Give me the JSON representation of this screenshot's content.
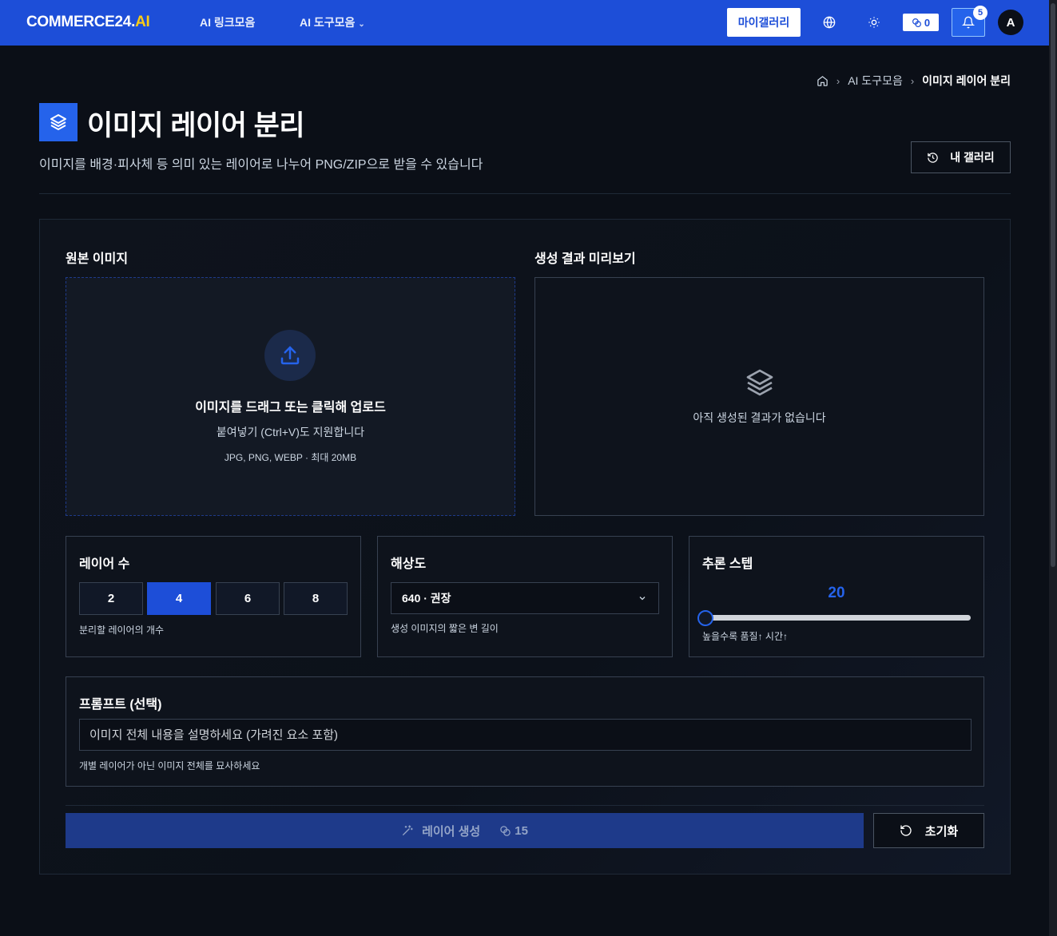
{
  "header": {
    "logo_main": "COMMERCE24.",
    "logo_accent": "AI",
    "nav": [
      {
        "label": "AI 링크모음"
      },
      {
        "label": "AI 도구모음"
      }
    ],
    "my_gallery_label": "마이갤러리",
    "credits": "0",
    "notification_count": "5",
    "avatar_initial": "A",
    "icons": {
      "language": "globe-icon",
      "theme": "sun-icon",
      "credits": "coins-icon",
      "notifications": "bell-icon"
    }
  },
  "breadcrumb": {
    "items": [
      "AI 도구모음",
      "이미지 레이어 분리"
    ]
  },
  "page": {
    "title": "이미지 레이어 분리",
    "subtitle": "이미지를 배경·피사체 등 의미 있는 레이어로 나누어 PNG/ZIP으로 받을 수 있습니다",
    "gallery_button": "내 갤러리"
  },
  "source": {
    "label": "원본 이미지",
    "upload_title": "이미지를 드래그 또는 클릭해 업로드",
    "upload_sub": "붙여넣기 (Ctrl+V)도 지원합니다",
    "upload_hint": "JPG, PNG, WEBP · 최대 20MB"
  },
  "preview": {
    "label": "생성 결과 미리보기",
    "empty_text": "아직 생성된 결과가 없습니다"
  },
  "layers": {
    "title": "레이어 수",
    "options": [
      "2",
      "4",
      "6",
      "8"
    ],
    "selected": "4",
    "help": "분리할 레이어의 개수"
  },
  "resolution": {
    "title": "해상도",
    "value": "640 · 권장",
    "help": "생성 이미지의 짧은 변 길이"
  },
  "steps": {
    "title": "추론 스텝",
    "value": "20",
    "slider_fraction": 0.0,
    "help": "높을수록 품질↑ 시간↑"
  },
  "prompt": {
    "title": "프롬프트 (선택)",
    "placeholder": "이미지 전체 내용을 설명하세요 (가려진 요소 포함)",
    "help": "개별 레이어가 아닌 이미지 전체를 묘사하세요"
  },
  "actions": {
    "generate_label": "레이어 생성",
    "generate_cost": "15",
    "reset_label": "초기화"
  },
  "colors": {
    "accent": "#1d4ed8",
    "logo_accent": "#facc15",
    "background": "#0b0f17"
  }
}
